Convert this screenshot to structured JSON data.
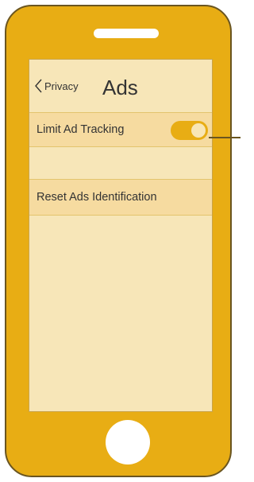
{
  "nav": {
    "back_label": "Privacy",
    "title": "Ads"
  },
  "settings": {
    "limit_ad_tracking": {
      "label": "Limit Ad Tracking",
      "enabled": true
    },
    "reset_ads_identification": {
      "label": "Reset Ads Identification"
    }
  },
  "colors": {
    "device_body": "#e8ad14",
    "screen_background": "#f7e6b8",
    "row_background": "#f6dba0",
    "toggle_on": "#e8ad14"
  },
  "icons": {
    "back": "chevron-left-icon"
  }
}
